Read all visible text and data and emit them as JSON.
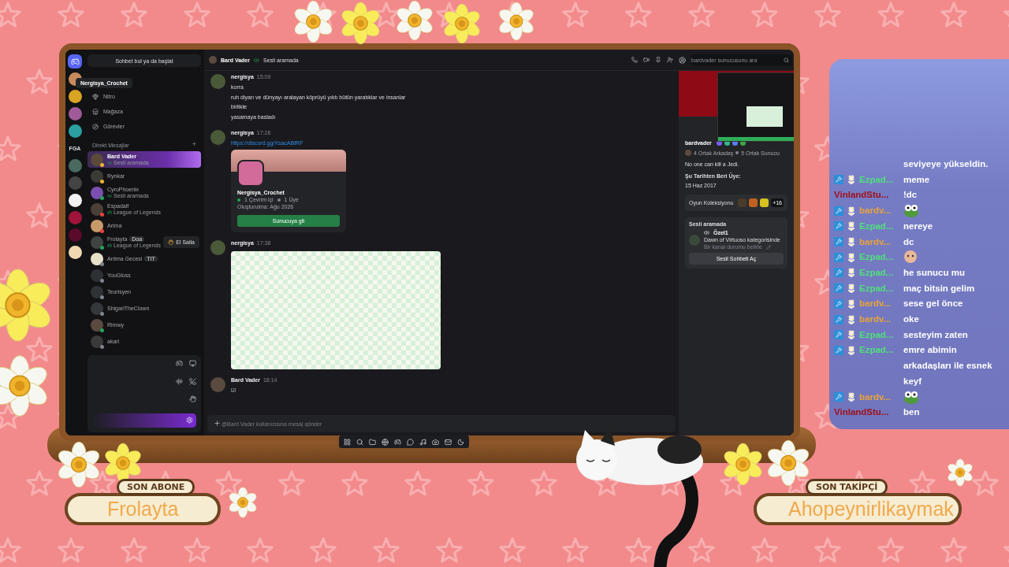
{
  "discord": {
    "search_button": "Sohbet bul ya da başlat",
    "tooltip": "Nergisya_Crochet",
    "server_label": "FGA",
    "nav": [
      "Nitro",
      "Mağaza",
      "Görevler"
    ],
    "dm_heading": "Direkt Mesajlar",
    "dm_add": "+",
    "dms": [
      {
        "name": "Bard Vader",
        "selected": true,
        "color": "#f0b232",
        "activity": {
          "kind": "voice",
          "text": "Sesli aramada"
        }
      },
      {
        "name": "Rynkar",
        "selected": false,
        "color": "#f0b232"
      },
      {
        "name": "CyroPhoenix",
        "selected": false,
        "color": "#23a55a",
        "activity": {
          "kind": "voice",
          "text": "Sesli aramada"
        }
      },
      {
        "name": "Espadalf",
        "selected": false,
        "color": "#f23f43",
        "activity": {
          "kind": "game",
          "text": "League of Legends"
        }
      },
      {
        "name": "Arima",
        "selected": false,
        "color": "#f23f43"
      },
      {
        "name": "Frolayta",
        "selected": false,
        "color": "#23a55a",
        "badge": "Doa",
        "wave_button": "El Salla",
        "activity": {
          "kind": "game",
          "text": "League of Legends"
        }
      },
      {
        "name": "Arıtma Gecesi",
        "selected": false,
        "color": "#80848e",
        "badge": "TIT"
      },
      {
        "name": "YouGloss",
        "selected": false,
        "color": "#80848e"
      },
      {
        "name": "Teorisyen",
        "selected": false,
        "color": "#80848e"
      },
      {
        "name": "ShigariTheClown",
        "selected": false,
        "color": "#80848e"
      },
      {
        "name": "Rimwy",
        "selected": false,
        "color": "#23a55a"
      },
      {
        "name": "akari",
        "selected": false,
        "color": "#80848e"
      }
    ],
    "header": {
      "name": "Bard Vader",
      "status": "Sesli aramada",
      "search_placeholder": "bardvader sunucusunu ara"
    },
    "messages": [
      {
        "kind": "text",
        "author": "nergisya",
        "time": "15:09",
        "lines": [
          "korra",
          "ruh diyarı ve dünyayı aralayan köprüyü yıktı bütün yaratıklar ve insanlar",
          "birlikte",
          "yasamaya basladı"
        ]
      },
      {
        "kind": "invite",
        "author": "nergisya",
        "time": "17:26",
        "link": "https://discord.gg/XsacABtRF",
        "invite": {
          "name": "Nergisya_Crochet",
          "online": "1 Çevrim içi",
          "members": "1 Üye",
          "created": "Oluşturulma: Ağu 2026",
          "button": "Sunucuya git"
        }
      },
      {
        "kind": "image",
        "author": "nergisya",
        "time": "17:38"
      },
      {
        "kind": "text",
        "author": "Bard Vader",
        "time": "18:14",
        "lines": [
          "☑"
        ]
      }
    ],
    "composer_placeholder": "@Bard Vader kullanıcısına mesaj gönder",
    "profile": {
      "username": "bardvader",
      "mutual_friends": "4 Ortak Arkadaş",
      "mutual_servers": "5 Ortak Sunucu",
      "bio": "No one can kill a Jedi.",
      "member_since_label": "Şu Tarihten Beri Üye:",
      "member_since": "15 Haz 2017",
      "games_label": "Oyun Koleksiyonu",
      "games_more": "+16",
      "voice": {
        "heading": "Sesli aramada",
        "channel": "Özel1",
        "category": "Dawn of Virtuoso kategorisinde",
        "status_hint": "Bir kanal durumu belirle",
        "button": "Sesli Sohbeti Aç"
      }
    }
  },
  "latest_subscriber": {
    "label": "SON ABONE",
    "name": "Frolayta"
  },
  "latest_follower": {
    "label": "SON TAKİPÇİ",
    "name": "Ahopeynirlikaymak"
  },
  "stream_chat": [
    {
      "kind": "notice",
      "text": "seviyeye yükseldin."
    },
    {
      "kind": "text",
      "author": "Ezpad...",
      "color": "#4fe07a",
      "badges": true,
      "text": "meme"
    },
    {
      "kind": "text",
      "author": "VinlandStu...",
      "color": "#a0101a",
      "badges": false,
      "text": "!dc"
    },
    {
      "kind": "frog-emote",
      "author": "bardv...",
      "color": "#e8a33a",
      "badges": true
    },
    {
      "kind": "text",
      "author": "Ezpad...",
      "color": "#4fe07a",
      "badges": true,
      "text": "nereye"
    },
    {
      "kind": "text",
      "author": "bardv...",
      "color": "#e8a33a",
      "badges": true,
      "text": "dc"
    },
    {
      "kind": "face-emote",
      "author": "Ezpad...",
      "color": "#4fe07a",
      "badges": true
    },
    {
      "kind": "text",
      "author": "Ezpad...",
      "color": "#4fe07a",
      "badges": true,
      "text": "he sunucu mu"
    },
    {
      "kind": "text",
      "author": "Ezpad...",
      "color": "#4fe07a",
      "badges": true,
      "text": "maç bitsin gelim"
    },
    {
      "kind": "text",
      "author": "bardv...",
      "color": "#e8a33a",
      "badges": true,
      "text": "sese gel önce"
    },
    {
      "kind": "text",
      "author": "bardv...",
      "color": "#e8a33a",
      "badges": true,
      "text": "oke"
    },
    {
      "kind": "text",
      "author": "Ezpad...",
      "color": "#4fe07a",
      "badges": true,
      "text": "sesteyim zaten"
    },
    {
      "kind": "text",
      "author": "Ezpad...",
      "color": "#4fe07a",
      "badges": true,
      "text": "emre abimin arkadaşları ile esnek keyf"
    },
    {
      "kind": "frog-emote",
      "author": "bardv...",
      "color": "#e8a33a",
      "badges": true
    },
    {
      "kind": "text",
      "author": "VinlandStu...",
      "color": "#a0101a",
      "badges": false,
      "text": "ben"
    }
  ]
}
